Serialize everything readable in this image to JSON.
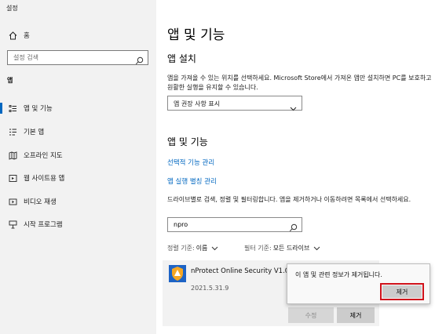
{
  "window": {
    "title": "설정"
  },
  "sidebar": {
    "home_label": "홈",
    "search_placeholder": "설정 검색",
    "section_label": "앱",
    "items": [
      {
        "label": "앱 및 기능",
        "icon": "apps-features-icon",
        "active": true
      },
      {
        "label": "기본 앱",
        "icon": "default-apps-icon"
      },
      {
        "label": "오프라인 지도",
        "icon": "offline-maps-icon"
      },
      {
        "label": "웹 사이트용 앱",
        "icon": "apps-websites-icon"
      },
      {
        "label": "비디오 재생",
        "icon": "video-playback-icon"
      },
      {
        "label": "시작 프로그램",
        "icon": "startup-icon"
      }
    ]
  },
  "main": {
    "page_title": "앱 및 기능",
    "install_heading": "앱 설치",
    "install_text": "앱을 가져올 수 있는 위치를 선택하세요. Microsoft Store에서 가져온 앱만 설치하면 PC를 보호하고 원활한 실행을 유지할 수 있습니다.",
    "install_dropdown_value": "앱 권장 사항 표시",
    "apps_heading": "앱 및 기능",
    "link_optional_features": "선택적 기능 관리",
    "link_app_aliases": "앱 실행 별칭 관리",
    "filter_text": "드라이브별로 검색, 정렬 및 필터링합니다. 앱을 제거하거나 이동하려면 목록에서 선택하세요.",
    "filter_value": "npro",
    "sort_key": "정렬 기준:",
    "sort_value": "이름",
    "filter_key": "필터 기준:",
    "filter_drive": "모든 드라이브"
  },
  "app_item": {
    "name": "nProtect Online Security V1.0(PFS)",
    "date": "2021.5.31.9",
    "modify_label": "수정",
    "uninstall_label": "제거"
  },
  "flyout": {
    "message": "이 앱 및 관련 정보가 제거됩니다.",
    "confirm_label": "제거"
  },
  "colors": {
    "accent": "#0067c0",
    "highlight": "#d0121b",
    "sidebar_bg": "#f2f2f2"
  }
}
